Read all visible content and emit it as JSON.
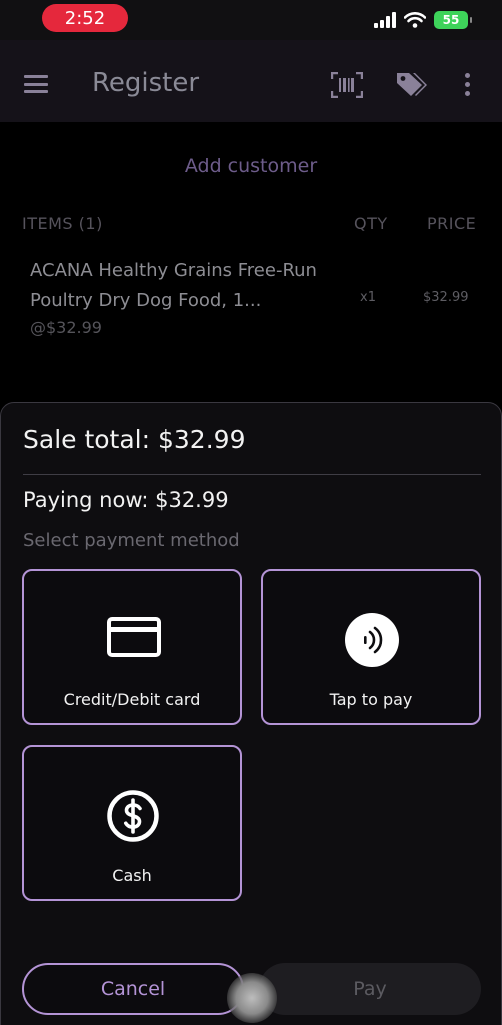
{
  "status_bar": {
    "time": "2:52",
    "battery": "55"
  },
  "app_bar": {
    "title": "Register",
    "icons": [
      "menu-icon",
      "barcode-scan-icon",
      "tags-icon",
      "more-vertical-icon"
    ]
  },
  "customer": {
    "add_label": "Add customer"
  },
  "items_table": {
    "headers": {
      "items": "ITEMS (1)",
      "qty": "QTY",
      "price": "PRICE"
    },
    "rows": [
      {
        "name": "ACANA Healthy Grains Free-Run Poultry Dry Dog Food, 1...",
        "unit_price": "@$32.99",
        "qty": "x1",
        "price": "$32.99"
      }
    ]
  },
  "payment_sheet": {
    "sale_total": "Sale total: $32.99",
    "paying_now": "Paying now: $32.99",
    "select_label": "Select payment method",
    "methods": [
      {
        "label": "Credit/Debit card",
        "icon": "credit-card-icon"
      },
      {
        "label": "Tap to pay",
        "icon": "contactless-icon"
      },
      {
        "label": "Cash",
        "icon": "dollar-circle-icon"
      }
    ],
    "cancel_label": "Cancel",
    "pay_label": "Pay"
  },
  "colors": {
    "accent": "#b494d6",
    "background": "#000000",
    "sheet": "#0e0d10",
    "time_pill": "#e5283c",
    "battery": "#3ed35a"
  }
}
